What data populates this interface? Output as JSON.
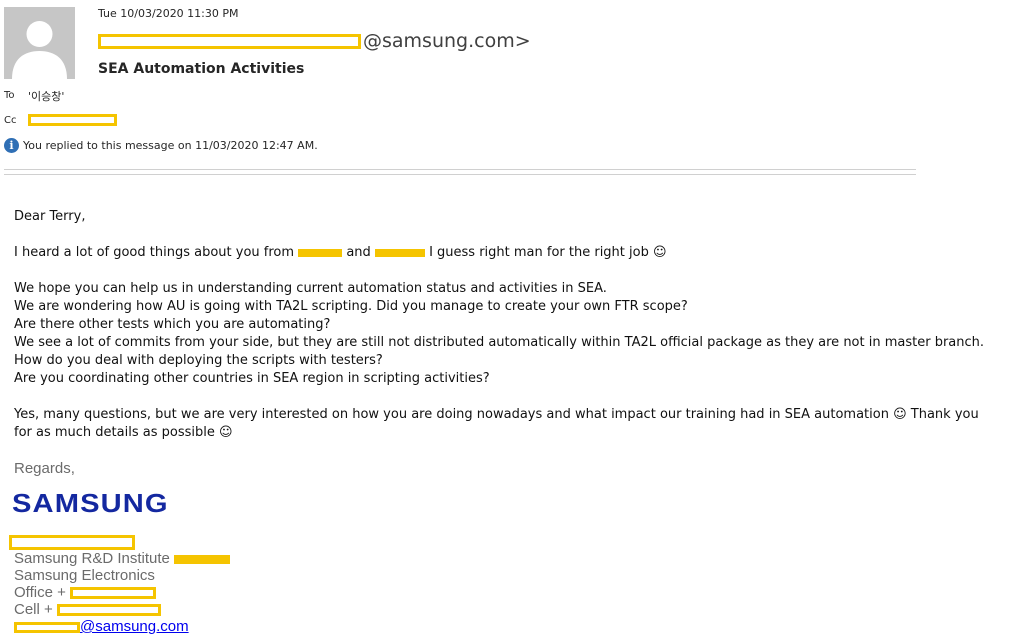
{
  "header": {
    "timestamp": "Tue 10/03/2020 11:30 PM",
    "sender_domain": "@samsung.com>",
    "subject": "SEA Automation Activities",
    "to_label": "To",
    "to_value": "'이승창'",
    "cc_label": "Cc",
    "reply_notice": "You replied to this message on 11/03/2020 12:47 AM."
  },
  "body": {
    "greeting": "Dear Terry,",
    "line1_a": "I heard a lot of good things about you from",
    "line1_b": "and",
    "line1_c": "I guess right man for the right job ☺",
    "para2": [
      "We hope you can help us in understanding current automation status and activities in SEA.",
      "We are wondering how AU is going with TA2L scripting. Did you manage to create your own FTR scope?",
      "Are there other tests which you are automating?",
      "We see a lot of commits from your side, but they are still not distributed automatically within TA2L official package as they are not in master branch.",
      "How do you deal with deploying the scripts with testers?",
      "Are you coordinating other countries in SEA region in scripting activities?"
    ],
    "para3": [
      "Yes, many questions, but we are very interested on how you are doing nowadays and what impact our training had in SEA automation ☺ Thank you",
      "for as much details as possible ☺"
    ]
  },
  "signature": {
    "regards": "Regards,",
    "logo_text": "SAMSUNG",
    "institute": "Samsung R&D Institute",
    "company": "Samsung Electronics",
    "office_prefix": "Office +",
    "cell_prefix": "Cell +",
    "email_domain": "@samsung.com"
  },
  "icons": {
    "avatar": "person-silhouette-icon",
    "info": "info-icon"
  },
  "colors": {
    "redaction": "#f5c400",
    "samsung_blue": "#1428a0",
    "link": "#0000ee",
    "avatar_bg": "#c6c6c6"
  }
}
